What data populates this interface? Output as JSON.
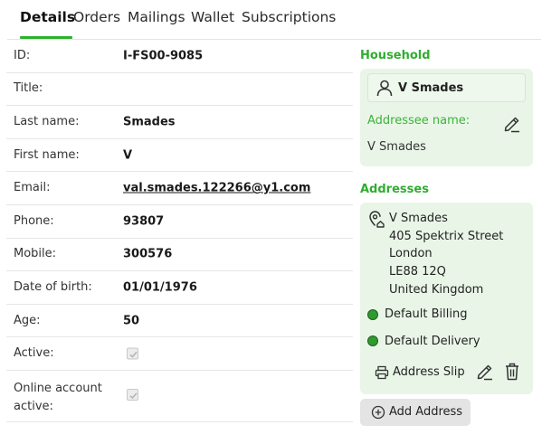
{
  "tabs": [
    {
      "label": "Details",
      "active": true
    },
    {
      "label": "Orders"
    },
    {
      "label": "Mailings"
    },
    {
      "label": "Wallet"
    },
    {
      "label": "Subscriptions"
    }
  ],
  "details": {
    "id": {
      "label": "ID:",
      "value": "I-FS00-9085"
    },
    "title": {
      "label": "Title:",
      "value": ""
    },
    "last_name": {
      "label": "Last name:",
      "value": "Smades"
    },
    "first_name": {
      "label": "First name:",
      "value": "V"
    },
    "email": {
      "label": "Email:",
      "value": "val.smades.122266@y1.com"
    },
    "phone": {
      "label": "Phone:",
      "value": "93807"
    },
    "mobile": {
      "label": "Mobile:",
      "value": "300576"
    },
    "dob": {
      "label": "Date of birth:",
      "value": "01/01/1976"
    },
    "age": {
      "label": "Age:",
      "value": "50"
    },
    "active": {
      "label": "Active:",
      "checked": true
    },
    "online_account": {
      "label_line1": "Online account",
      "label_line2": "active:",
      "checked": true
    }
  },
  "household": {
    "title": "Household",
    "name": "V Smades",
    "addressee_label": "Addressee name:",
    "addressee_value": "V Smades"
  },
  "addresses": {
    "title": "Addresses",
    "items": [
      {
        "name": "V Smades",
        "line1": "405 Spektrix Street",
        "city": "London",
        "postcode": "LE88 12Q",
        "country": "United Kingdom",
        "default_billing": "Default Billing",
        "default_delivery": "Default Delivery",
        "slip_label": "Address Slip"
      }
    ],
    "add_label": "Add Address"
  },
  "colors": {
    "accent_green": "#2db12d",
    "panel_bg": "#e9f6e7",
    "status_dot": "#2f9a2f"
  }
}
